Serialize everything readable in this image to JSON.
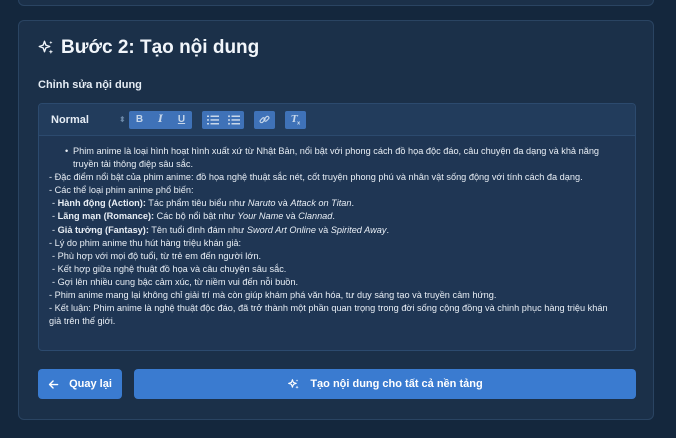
{
  "step": {
    "title": "Bước 2: Tạo nội dung",
    "icon": "sparkles-icon"
  },
  "editor": {
    "label": "Chỉnh sửa nội dung",
    "toolbar": {
      "format_select": "Normal",
      "buttons": [
        "bold-icon",
        "italic-icon",
        "underline-icon",
        "ordered-list-icon",
        "bullet-list-icon",
        "link-icon",
        "clear-format-icon"
      ]
    },
    "content": {
      "bullet_intro": "Phim anime là loại hình hoạt hình xuất xứ từ Nhật Bản, nổi bật với phong cách đồ họa độc đáo, câu chuyện đa dạng và khả năng truyền tải thông điệp sâu sắc.",
      "line_features": "- Đặc điểm nổi bật của phim anime: đồ họa nghệ thuật sắc nét, cốt truyện phong phú và nhân vật sống động với tính cách đa dạng.",
      "line_genres": "- Các thể loại phim anime phổ biến:",
      "genre_action_label": "Hành động (Action):",
      "genre_action_text": " Tác phẩm tiêu biểu như ",
      "genre_action_title1": "Naruto",
      "genre_action_and": " và ",
      "genre_action_title2": "Attack on Titan",
      "genre_action_end": ".",
      "genre_romance_label": "Lãng mạn (Romance):",
      "genre_romance_text": " Các bộ nổi bật như ",
      "genre_romance_title1": "Your Name",
      "genre_romance_and": " và ",
      "genre_romance_title2": "Clannad",
      "genre_romance_end": ".",
      "genre_fantasy_label": "Giả tưởng (Fantasy):",
      "genre_fantasy_text": " Tên tuổi đình đám như ",
      "genre_fantasy_title1": "Sword Art Online",
      "genre_fantasy_and": " và ",
      "genre_fantasy_title2": "Spirited Away",
      "genre_fantasy_end": ".",
      "line_reasons": "- Lý do phim anime thu hút hàng triệu khán giả:",
      "reason_1": "- Phù hợp với mọi độ tuổi, từ trẻ em đến người lớn.",
      "reason_2": "- Kết hợp giữa nghệ thuật đồ họa và câu chuyện sâu sắc.",
      "reason_3": "- Gợi lên nhiều cung bậc cảm xúc, từ niềm vui đến nỗi buồn.",
      "line_value": "- Phim anime mang lại không chỉ giải trí mà còn giúp khám phá văn hóa, tư duy sáng tạo và truyền cảm hứng.",
      "line_conclusion": "- Kết luận: Phim anime là nghệ thuật độc đáo, đã trở thành một phần quan trọng trong đời sống cộng đồng và chinh phục hàng triệu khán giả trên thế giới."
    }
  },
  "actions": {
    "back_label": "Quay lại",
    "generate_label": "Tạo nội dung cho tất cả nền tảng"
  }
}
